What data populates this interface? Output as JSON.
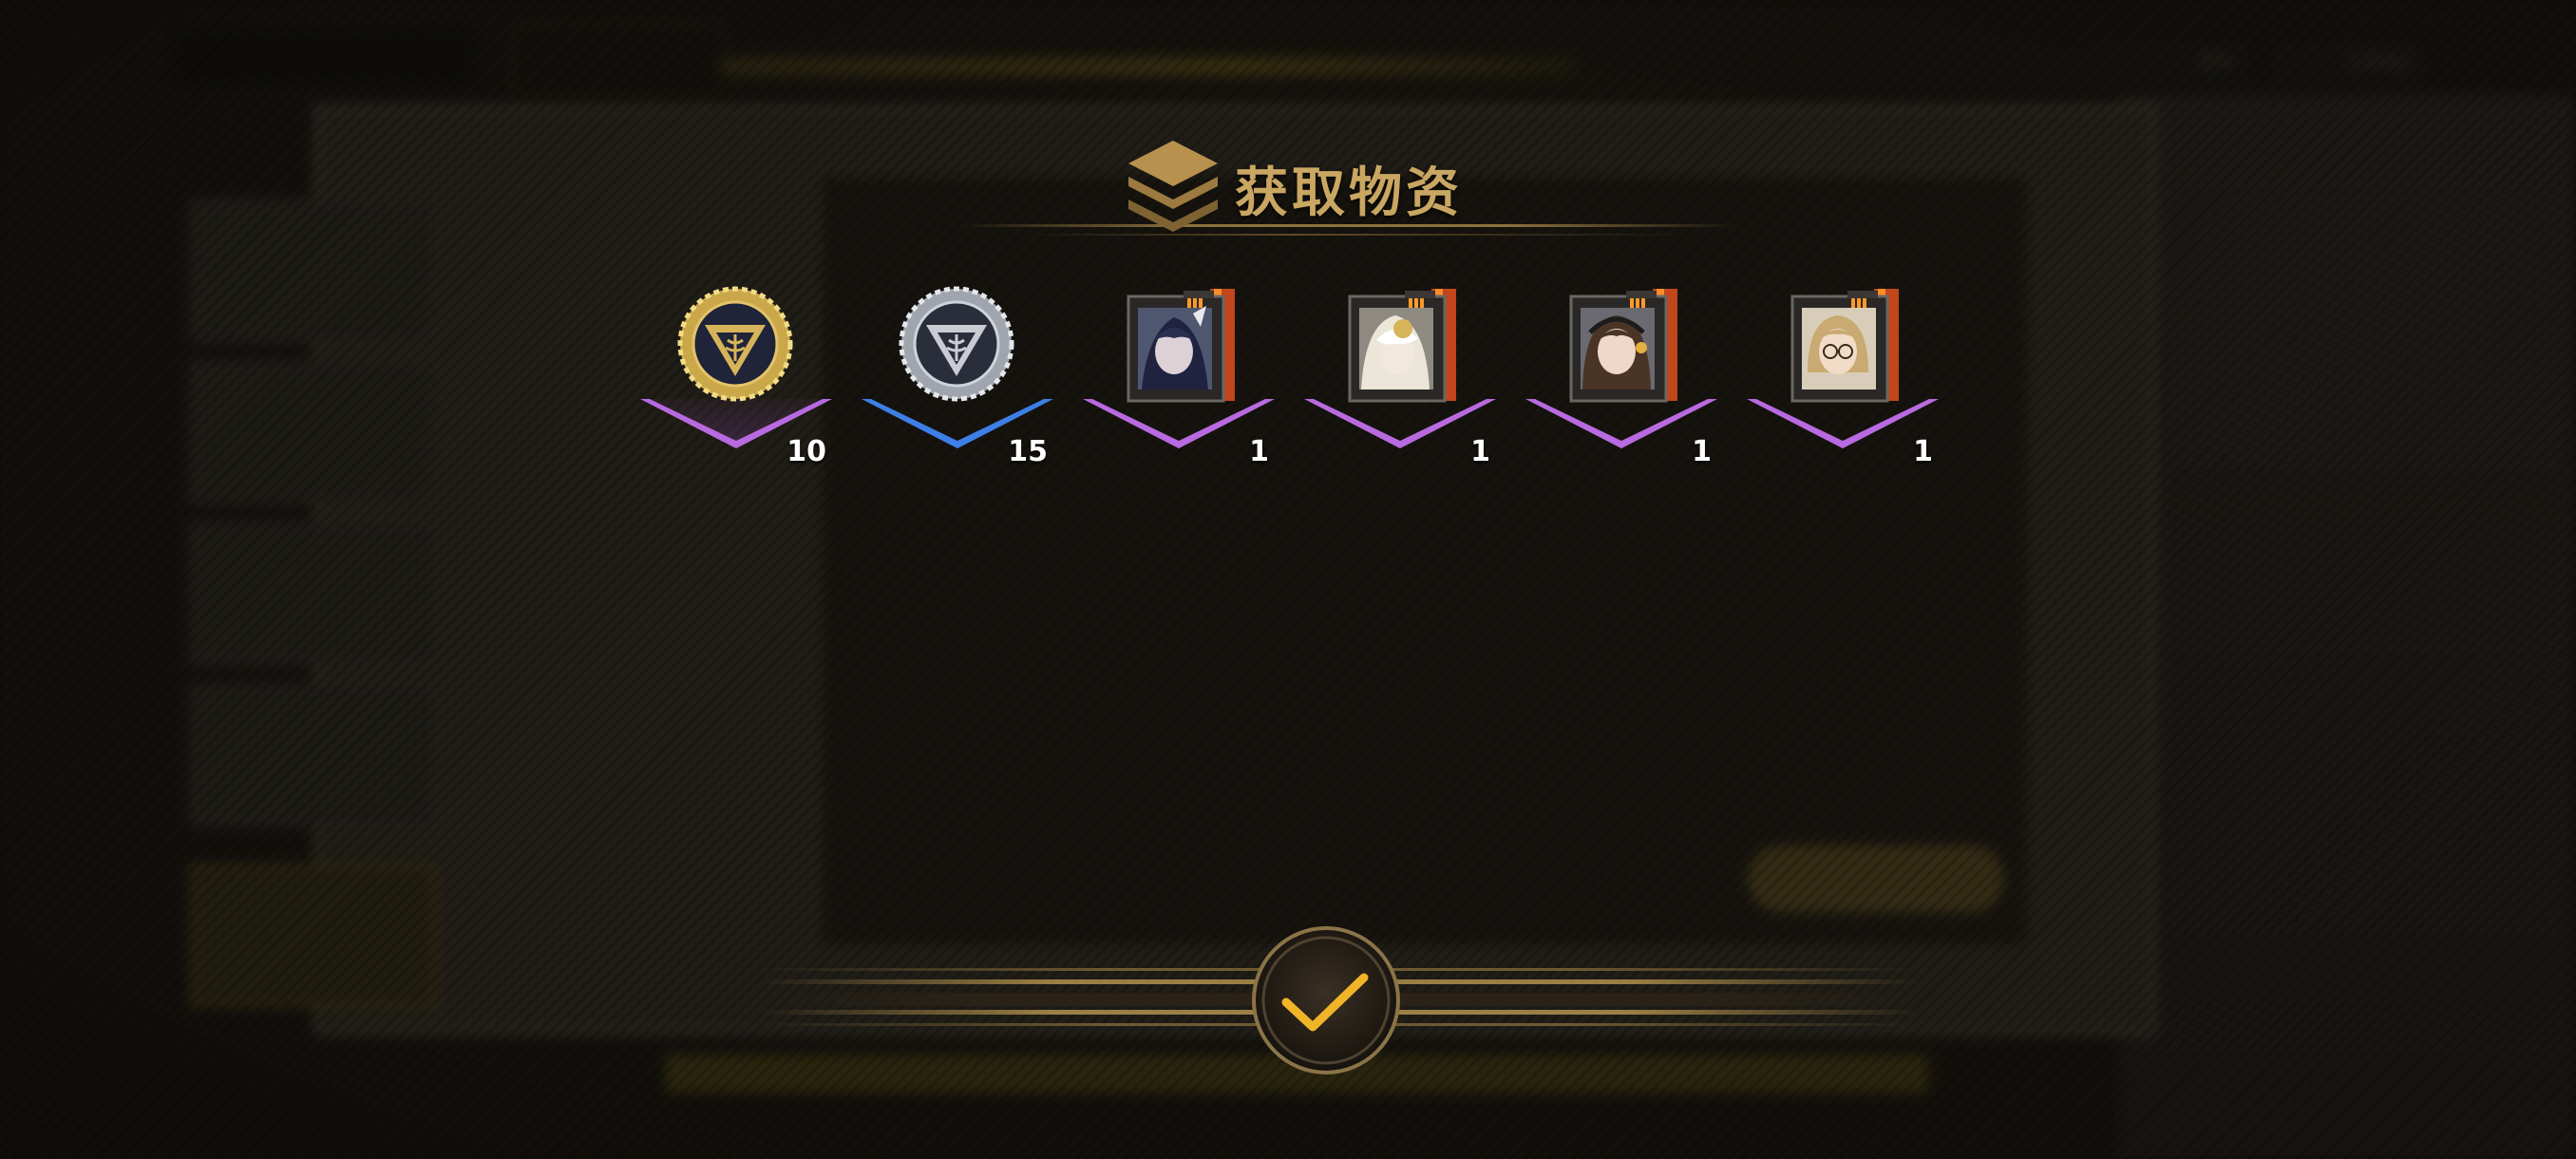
{
  "dialog": {
    "title": "获取物资",
    "confirm_icon": "checkmark-icon"
  },
  "rewards": [
    {
      "item": "gold-triangle-emblem-coin-icon",
      "quantity": "10",
      "rarity": "purple"
    },
    {
      "item": "silver-triangle-emblem-coin-icon",
      "quantity": "15",
      "rarity": "blue"
    },
    {
      "item": "character-file-dark-hair",
      "quantity": "1",
      "rarity": "purple"
    },
    {
      "item": "character-file-white-hair-mask",
      "quantity": "1",
      "rarity": "purple"
    },
    {
      "item": "character-file-brown-hair-headset",
      "quantity": "1",
      "rarity": "purple"
    },
    {
      "item": "character-file-blonde-glasses",
      "quantity": "1",
      "rarity": "purple"
    }
  ],
  "background": {
    "resource_1": "99",
    "resource_2": "1442"
  },
  "colors": {
    "title_gold": "#c9a662",
    "rarity_purple": "#a14fd0",
    "rarity_blue": "#2f6fd8",
    "confirm_gold": "#f0b429"
  }
}
